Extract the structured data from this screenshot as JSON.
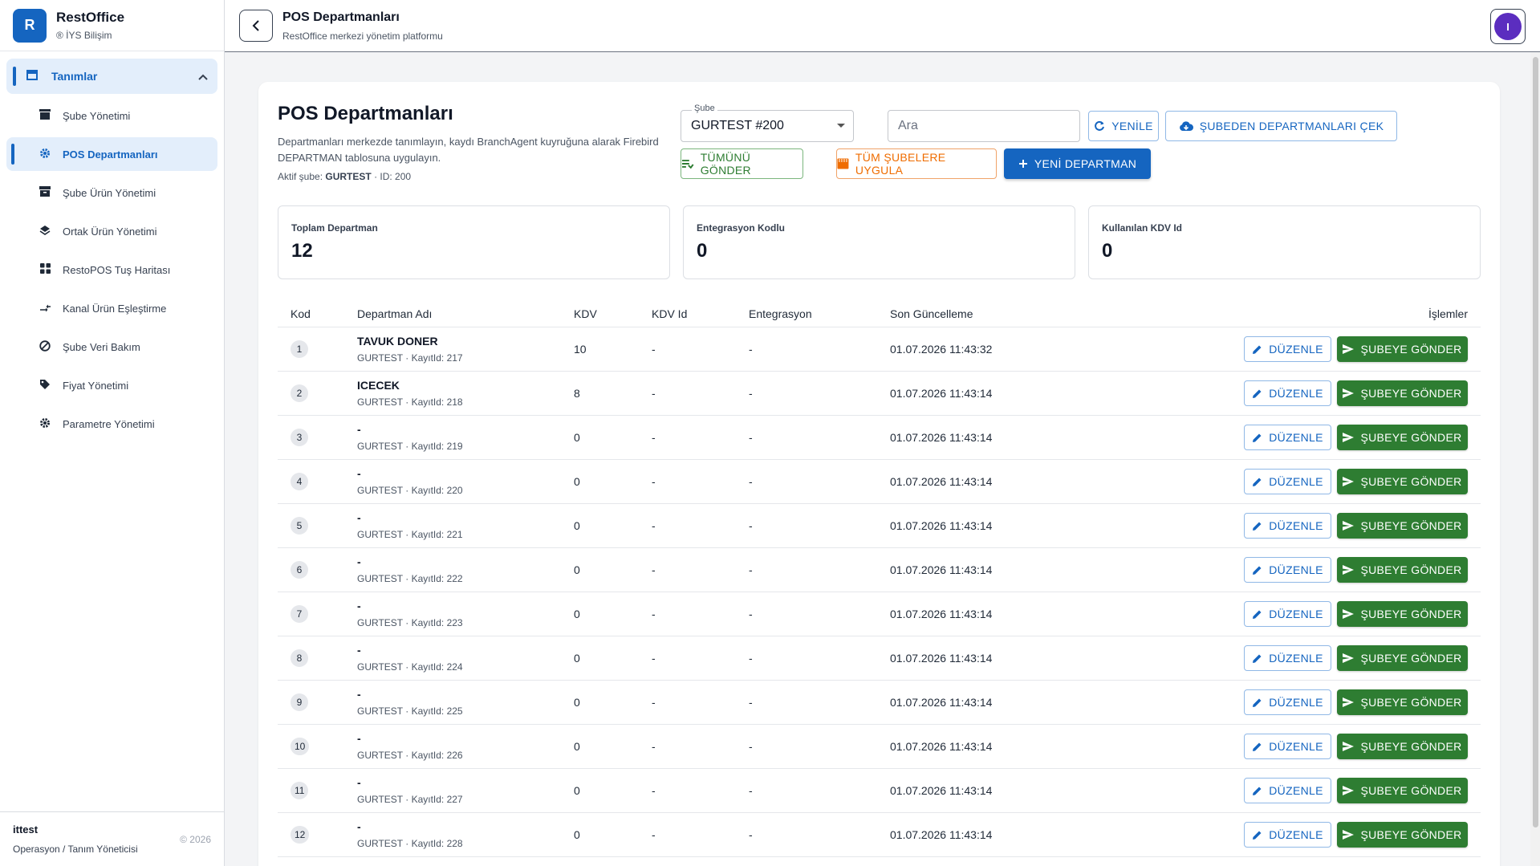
{
  "brand": {
    "logo": "R",
    "title": "RestOffice",
    "subtitle": "® İYS Bilişim"
  },
  "sidebar": {
    "group": {
      "label": "Tanımlar",
      "icon": "store-icon"
    },
    "items": [
      {
        "label": "Şube Yönetimi",
        "icon": "store-icon",
        "active": false
      },
      {
        "label": "POS Departmanları",
        "icon": "gear-icon",
        "active": true
      },
      {
        "label": "Şube Ürün Yönetimi",
        "icon": "archive-icon",
        "active": false
      },
      {
        "label": "Ortak Ürün Yönetimi",
        "icon": "layers-icon",
        "active": false
      },
      {
        "label": "RestoPOS Tuş Haritası",
        "icon": "grid-icon",
        "active": false
      },
      {
        "label": "Kanal Ürün Eşleştirme",
        "icon": "compare-arrows-icon",
        "active": false
      },
      {
        "label": "Şube Veri Bakım",
        "icon": "block-icon",
        "active": false
      },
      {
        "label": "Fiyat Yönetimi",
        "icon": "tag-icon",
        "active": false
      },
      {
        "label": "Parametre Yönetimi",
        "icon": "gear-icon",
        "active": false
      }
    ],
    "footer": {
      "user": "ittest",
      "role": "Operasyon / Tanım Yöneticisi",
      "copyright": "© 2026"
    }
  },
  "header": {
    "title": "POS Departmanları",
    "subtitle": "RestOffice merkezi yönetim platformu",
    "avatar": "I"
  },
  "page": {
    "title": "POS Departmanları",
    "description": "Departmanları merkezde tanımlayın, kaydı BranchAgent kuyruğuna alarak Firebird DEPARTMAN tablosuna uygulayın.",
    "active_prefix": "Aktif şube:",
    "active_branch": "GURTEST",
    "active_suffix": "· ID: 200"
  },
  "toolbar": {
    "branch_label": "Şube",
    "branch_value": "GURTEST #200",
    "search_placeholder": "Ara",
    "refresh": "YENİLE",
    "pull": "ŞUBEDEN DEPARTMANLARI ÇEK",
    "send_all": "TÜMÜNÜ GÖNDER",
    "apply_all": "TÜM ŞUBELERE UYGULA",
    "new": "YENİ DEPARTMAN"
  },
  "stats": [
    {
      "label": "Toplam Departman",
      "value": "12"
    },
    {
      "label": "Entegrasyon Kodlu",
      "value": "0"
    },
    {
      "label": "Kullanılan KDV Id",
      "value": "0"
    }
  ],
  "table": {
    "headers": {
      "kod": "Kod",
      "ad": "Departman Adı",
      "kdv": "KDV",
      "kdvid": "KDV Id",
      "ent": "Entegrasyon",
      "son": "Son Güncelleme",
      "isl": "İşlemler"
    },
    "edit_label": "DÜZENLE",
    "send_label": "ŞUBEYE GÖNDER",
    "rows": [
      {
        "kod": "1",
        "name": "TAVUK DONER",
        "meta": "GURTEST · KayıtId: 217",
        "kdv": "10",
        "kdvid": "-",
        "ent": "-",
        "updated": "01.07.2026 11:43:32"
      },
      {
        "kod": "2",
        "name": "ICECEK",
        "meta": "GURTEST · KayıtId: 218",
        "kdv": "8",
        "kdvid": "-",
        "ent": "-",
        "updated": "01.07.2026 11:43:14"
      },
      {
        "kod": "3",
        "name": "-",
        "meta": "GURTEST · KayıtId: 219",
        "kdv": "0",
        "kdvid": "-",
        "ent": "-",
        "updated": "01.07.2026 11:43:14"
      },
      {
        "kod": "4",
        "name": "-",
        "meta": "GURTEST · KayıtId: 220",
        "kdv": "0",
        "kdvid": "-",
        "ent": "-",
        "updated": "01.07.2026 11:43:14"
      },
      {
        "kod": "5",
        "name": "-",
        "meta": "GURTEST · KayıtId: 221",
        "kdv": "0",
        "kdvid": "-",
        "ent": "-",
        "updated": "01.07.2026 11:43:14"
      },
      {
        "kod": "6",
        "name": "-",
        "meta": "GURTEST · KayıtId: 222",
        "kdv": "0",
        "kdvid": "-",
        "ent": "-",
        "updated": "01.07.2026 11:43:14"
      },
      {
        "kod": "7",
        "name": "-",
        "meta": "GURTEST · KayıtId: 223",
        "kdv": "0",
        "kdvid": "-",
        "ent": "-",
        "updated": "01.07.2026 11:43:14"
      },
      {
        "kod": "8",
        "name": "-",
        "meta": "GURTEST · KayıtId: 224",
        "kdv": "0",
        "kdvid": "-",
        "ent": "-",
        "updated": "01.07.2026 11:43:14"
      },
      {
        "kod": "9",
        "name": "-",
        "meta": "GURTEST · KayıtId: 225",
        "kdv": "0",
        "kdvid": "-",
        "ent": "-",
        "updated": "01.07.2026 11:43:14"
      },
      {
        "kod": "10",
        "name": "-",
        "meta": "GURTEST · KayıtId: 226",
        "kdv": "0",
        "kdvid": "-",
        "ent": "-",
        "updated": "01.07.2026 11:43:14"
      },
      {
        "kod": "11",
        "name": "-",
        "meta": "GURTEST · KayıtId: 227",
        "kdv": "0",
        "kdvid": "-",
        "ent": "-",
        "updated": "01.07.2026 11:43:14"
      },
      {
        "kod": "12",
        "name": "-",
        "meta": "GURTEST · KayıtId: 228",
        "kdv": "0",
        "kdvid": "-",
        "ent": "-",
        "updated": "01.07.2026 11:43:14"
      }
    ]
  },
  "colors": {
    "primary": "#1565c0",
    "success": "#2e7d32",
    "warning": "#ef6c00",
    "avatar": "#5b2dbf"
  }
}
